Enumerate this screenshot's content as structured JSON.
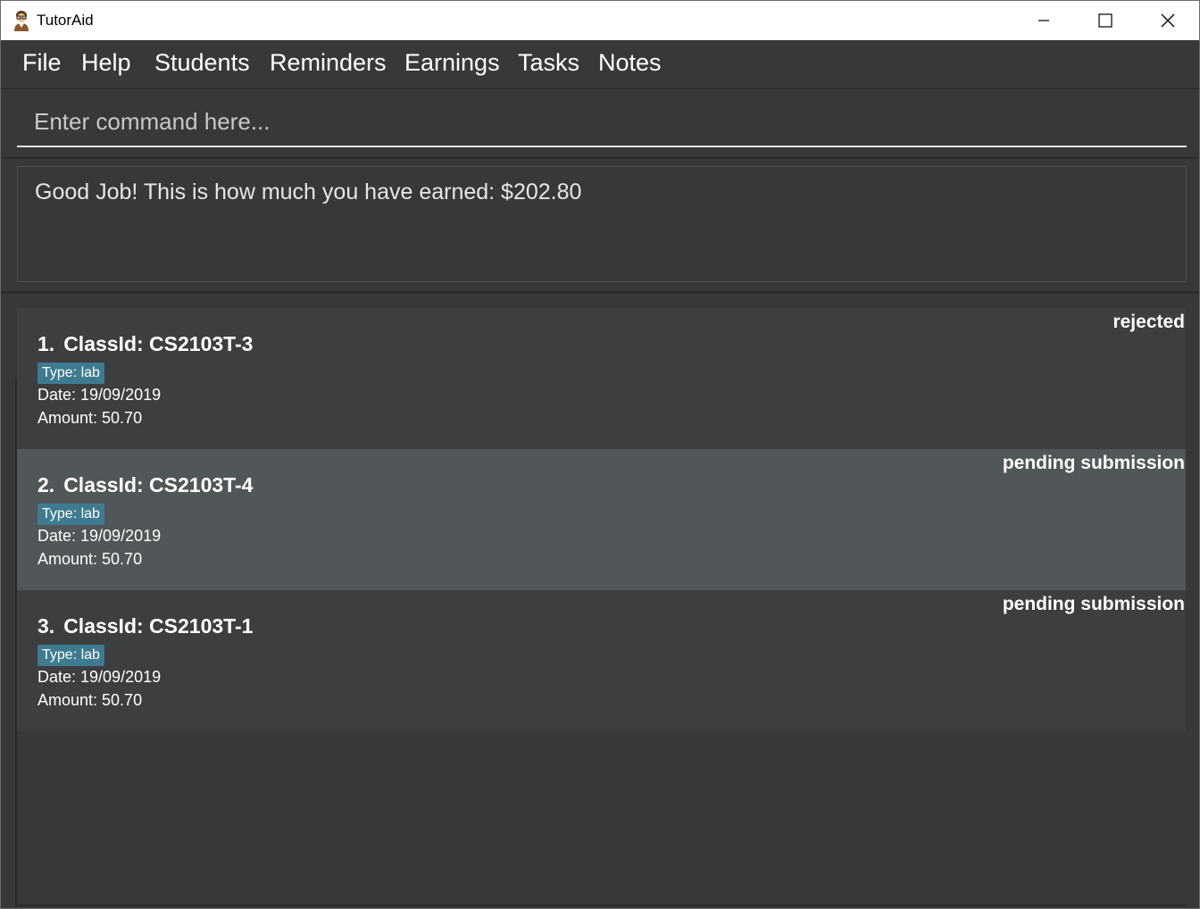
{
  "window": {
    "title": "TutorAid",
    "icon": "tutor-avatar-icon"
  },
  "menu": {
    "items": [
      "File",
      "Help",
      "Students",
      "Reminders",
      "Earnings",
      "Tasks",
      "Notes"
    ]
  },
  "command": {
    "placeholder": "Enter command here..."
  },
  "result": {
    "message": "Good Job! This is how much you have earned: $202.80"
  },
  "earnings": [
    {
      "index": "1.",
      "class_id": "ClassId: CS2103T-3",
      "status": "rejected",
      "type": "Type: lab",
      "date": "Date: 19/09/2019",
      "amount": "Amount: 50.70"
    },
    {
      "index": "2.",
      "class_id": "ClassId: CS2103T-4",
      "status": "pending submission",
      "type": "Type: lab",
      "date": "Date: 19/09/2019",
      "amount": "Amount: 50.70"
    },
    {
      "index": "3.",
      "class_id": "ClassId: CS2103T-1",
      "status": "pending submission",
      "type": "Type: lab",
      "date": "Date: 19/09/2019",
      "amount": "Amount: 50.70"
    }
  ],
  "colors": {
    "background": "#383838",
    "card_odd": "#3c3e3f",
    "card_selected": "#515658",
    "tag": "#3e7b91"
  }
}
